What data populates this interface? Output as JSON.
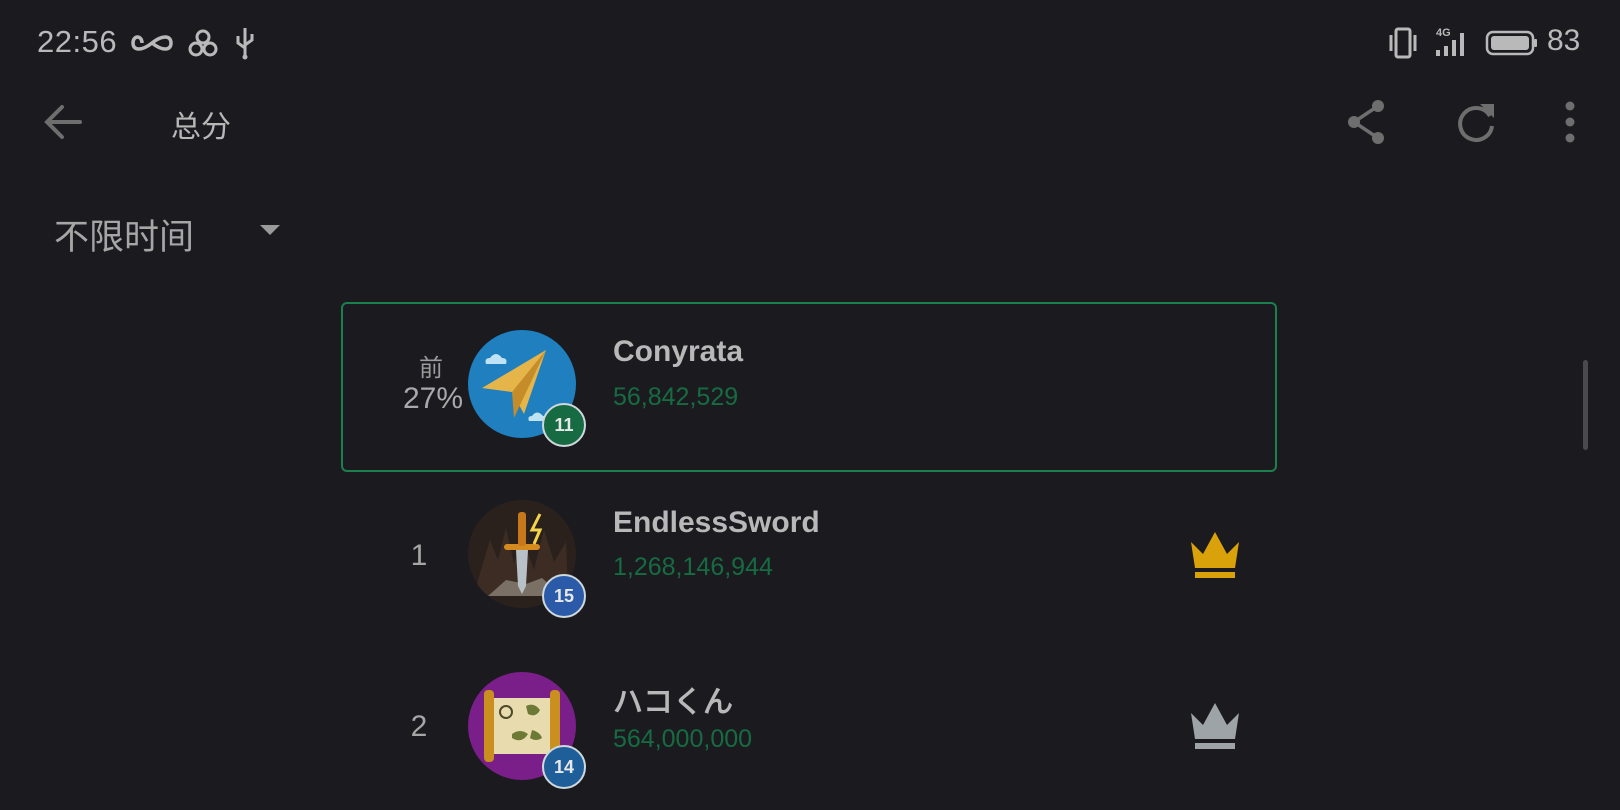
{
  "status": {
    "time": "22:56",
    "signal_label": "4G",
    "battery": "83",
    "icons": [
      "infinity-icon",
      "link-icon",
      "usb-icon",
      "vibrate-icon",
      "signal-icon",
      "battery-icon"
    ]
  },
  "appbar": {
    "title": "总分",
    "back_icon": "arrow-left-icon",
    "actions": [
      "share-icon",
      "refresh-icon",
      "more-vert-icon"
    ]
  },
  "filter": {
    "selected": "不限时间"
  },
  "player": {
    "prefix": "前",
    "percentile": "27%",
    "name": "Conyrata",
    "score": "56,842,529",
    "level": "11"
  },
  "leaderboard": [
    {
      "rank": "1",
      "name": "EndlessSword",
      "score": "1,268,146,944",
      "level": "15",
      "crown": "gold-crown-icon"
    },
    {
      "rank": "2",
      "name": "ハコくん",
      "score": "564,000,000",
      "level": "14",
      "crown": "silver-crown-icon"
    }
  ],
  "colors": {
    "background": "#1b1b1f",
    "card_border": "#1b7f4e",
    "score_text": "#176b43",
    "gold": "#d9a10a",
    "silver": "#9ea3a7"
  }
}
